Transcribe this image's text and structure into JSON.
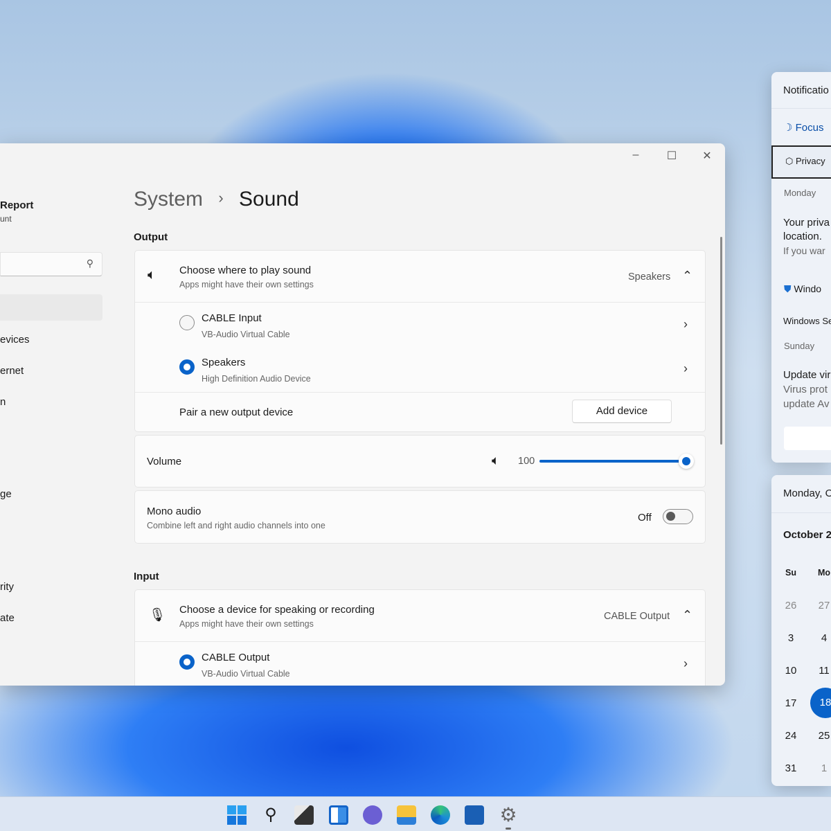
{
  "window": {
    "controls": {
      "minimize": "–",
      "maximize": "☐",
      "close": "✕"
    }
  },
  "sidebar": {
    "user_name": "Report",
    "user_sub": "unt",
    "items": [
      "evices",
      "ernet",
      "n",
      "ge",
      "rity",
      "ate"
    ]
  },
  "header": {
    "breadcrumb_parent": "System",
    "separator": "›",
    "title": "Sound"
  },
  "output": {
    "heading": "Output",
    "choose": {
      "title": "Choose where to play sound",
      "subtitle": "Apps might have their own settings",
      "value": "Speakers"
    },
    "devices": [
      {
        "name": "CABLE Input",
        "desc": "VB-Audio Virtual Cable",
        "selected": false
      },
      {
        "name": "Speakers",
        "desc": "High Definition Audio Device",
        "selected": true
      }
    ],
    "pair": {
      "label": "Pair a new output device",
      "button": "Add device"
    },
    "volume": {
      "label": "Volume",
      "value": "100",
      "percent": 100
    },
    "mono": {
      "title": "Mono audio",
      "subtitle": "Combine left and right audio channels into one",
      "state": "Off"
    }
  },
  "input": {
    "heading": "Input",
    "choose": {
      "title": "Choose a device for speaking or recording",
      "subtitle": "Apps might have their own settings",
      "value": "CABLE Output"
    },
    "devices": [
      {
        "name": "CABLE Output",
        "desc": "VB-Audio Virtual Cable",
        "selected": true
      }
    ]
  },
  "notifications": {
    "title": "Notificatio",
    "focus": "Focus",
    "privacy": "Privacy",
    "day1": "Monday",
    "msg1_title": "Your priva",
    "msg1_title2": "location.",
    "msg1_body": "If you war",
    "app2": "Windo",
    "group": "Windows Se",
    "day2": "Sunday",
    "msg2_title": "Update vir",
    "msg2_body": "Virus prot",
    "msg2_body2": "update Av"
  },
  "calendar": {
    "date_header": "Monday, O",
    "month": "October 2",
    "weekdays": [
      "Su",
      "Mo"
    ],
    "rows": [
      [
        "26",
        "27"
      ],
      [
        "3",
        "4"
      ],
      [
        "10",
        "11"
      ],
      [
        "17",
        "18"
      ],
      [
        "24",
        "25"
      ],
      [
        "31",
        "1"
      ]
    ],
    "today": "18",
    "accent": "#0a63c9"
  },
  "taskbar": {
    "icons": [
      "start-icon",
      "search-icon",
      "task-view-icon",
      "widgets-icon",
      "teams-chat-icon",
      "file-explorer-icon",
      "edge-icon",
      "store-icon",
      "settings-icon"
    ]
  }
}
